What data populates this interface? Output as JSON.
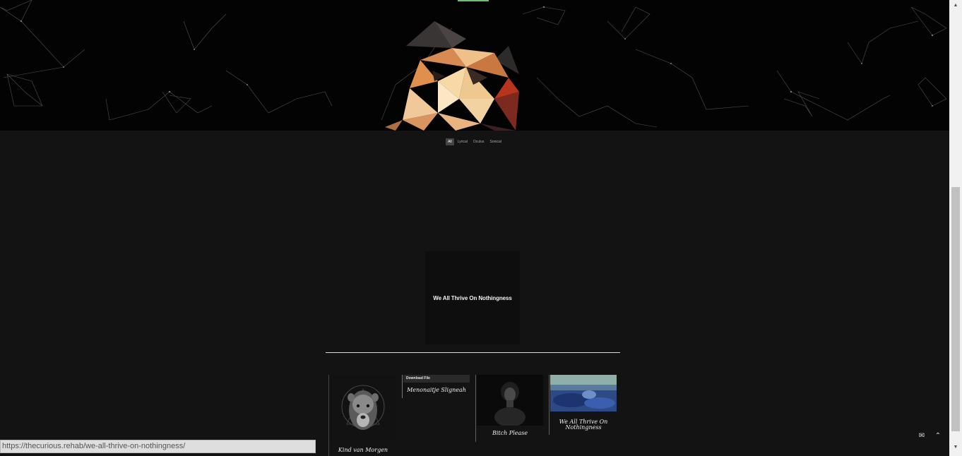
{
  "filters": {
    "items": [
      {
        "label": "All",
        "active": true
      },
      {
        "label": "Lyrical",
        "active": false
      },
      {
        "label": "Oculus",
        "active": false
      },
      {
        "label": "Sonical",
        "active": false
      }
    ]
  },
  "feature": {
    "title": "We All Thrive On Nothingness"
  },
  "cards": {
    "lion": {
      "caption": "Kind van Morgen",
      "image": "lioness-artwork"
    },
    "download": {
      "button_label": "Download File",
      "caption": "Menonaitje Sligneah"
    },
    "portrait": {
      "caption": "Bitch Please",
      "image": "woman-portrait-photo"
    },
    "water": {
      "caption": "We All Thrive On Nothingness",
      "image": "blue-water-photo"
    }
  },
  "status_bar": {
    "url": "https://thecurious.rehab/we-all-thrive-on-nothingness/"
  },
  "floating_buttons": {
    "mail_icon": "mail-icon",
    "top_icon": "chevron-up-icon"
  },
  "colors": {
    "page_background": "#131313",
    "hero_background": "#030303",
    "accent": "#6fbf73",
    "card_line": "#3a6a8a"
  }
}
